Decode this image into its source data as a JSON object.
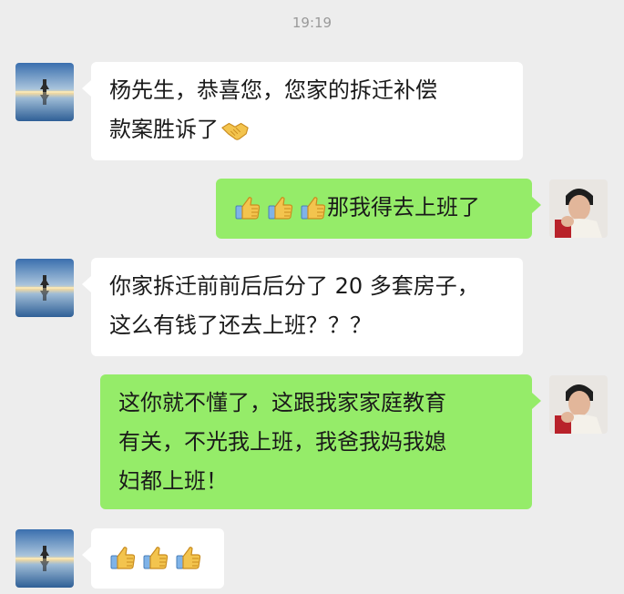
{
  "timestamp": "19:19",
  "messages": [
    {
      "side": "left",
      "lines": [
        "杨先生，恭喜您，您家的拆迁补偿",
        "款案胜诉了"
      ],
      "emoji_after": "handshake-icon"
    },
    {
      "side": "right",
      "emoji_before": [
        "thumbs-up-icon",
        "thumbs-up-icon",
        "thumbs-up-icon"
      ],
      "text": "那我得去上班了"
    },
    {
      "side": "left",
      "lines": [
        "你家拆迁前前后后分了 20 多套房子，",
        "这么有钱了还去上班？？？"
      ]
    },
    {
      "side": "right",
      "lines": [
        "这你就不懂了，这跟我家家庭教育",
        "有关，不光我上班，我爸我妈我媳",
        "妇都上班！"
      ]
    },
    {
      "side": "left",
      "emoji_only": [
        "thumbs-up-icon",
        "thumbs-up-icon",
        "thumbs-up-icon"
      ]
    }
  ],
  "colors": {
    "background": "#ededed",
    "incoming_bubble": "#ffffff",
    "outgoing_bubble": "#95ec69",
    "timestamp": "#9a9a9a"
  }
}
